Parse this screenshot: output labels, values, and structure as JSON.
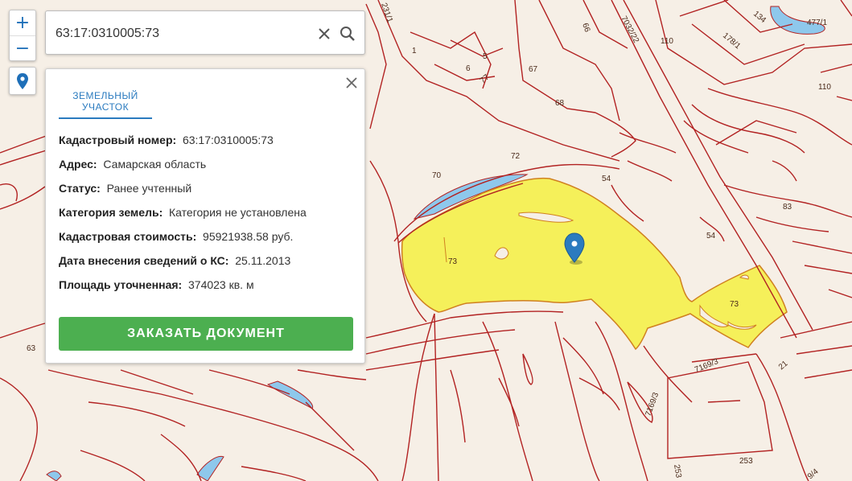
{
  "zoom": {
    "plus": "+",
    "minus": "−"
  },
  "search": {
    "value": "63:17:0310005:73"
  },
  "card": {
    "tab_label_line1": "ЗЕМЕЛЬНЫЙ",
    "tab_label_line2": "УЧАСТОК",
    "fields": [
      {
        "label": "Кадастровый номер:",
        "value": "63:17:0310005:73"
      },
      {
        "label": "Адрес:",
        "value": "Самарская область"
      },
      {
        "label": "Статус:",
        "value": "Ранее учтенный"
      },
      {
        "label": "Категория земель:",
        "value": "Категория не установлена"
      },
      {
        "label": "Кадастровая стоимость:",
        "value": "95921938.58 руб."
      },
      {
        "label": "Дата внесения сведений о КС:",
        "value": "25.11.2013"
      },
      {
        "label": "Площадь уточненная:",
        "value": "374023 кв. м"
      }
    ],
    "order_button": "ЗАКАЗАТЬ ДОКУМЕНТ"
  },
  "map_labels": {
    "l1": "1",
    "l5": "5",
    "l6": "6",
    "l77": "77",
    "l67": "67",
    "l66": "66",
    "l68": "68",
    "l72": "72",
    "l70": "70",
    "l54a": "54",
    "l54b": "54",
    "l83": "83",
    "l73a": "73",
    "l73b": "73",
    "l110a": "110",
    "l110b": "110",
    "l134": "134",
    "l477": "477/1",
    "l178": "178/1",
    "l7032": "7032/22",
    "l231": "231/1",
    "l63": "63",
    "l7169a": "7169/3",
    "l7169b": "7169/3",
    "l21": "21",
    "l253a": "253",
    "l253b": "253",
    "l94": "9/4"
  },
  "colors": {
    "parcel_line": "#b22222",
    "selected_fill": "#f5f05a",
    "water": "#8ec8ec",
    "accent": "#2b7bbf",
    "button": "#4caf50"
  },
  "icons": {
    "clear": "close-icon",
    "search": "search-icon",
    "location": "location-pin-icon",
    "marker": "map-marker-icon"
  }
}
